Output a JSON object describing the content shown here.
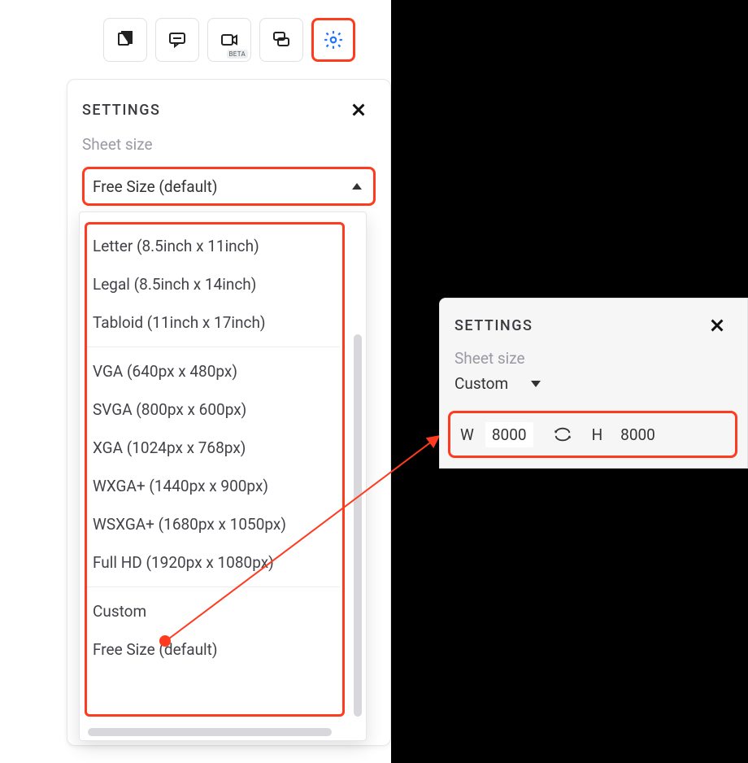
{
  "toolbar": {
    "beta_label": "BETA"
  },
  "panel_left": {
    "title": "SETTINGS",
    "section_label": "Sheet size",
    "selected": "Free Size (default)"
  },
  "dropdown": {
    "group1": [
      "Letter (8.5inch x 11inch)",
      "Legal (8.5inch x 14inch)",
      "Tabloid (11inch x 17inch)"
    ],
    "group2": [
      "VGA (640px x 480px)",
      "SVGA (800px x 600px)",
      "XGA (1024px x 768px)",
      "WXGA+ (1440px x 900px)",
      "WSXGA+ (1680px x 1050px)",
      "Full HD (1920px x 1080px)"
    ],
    "group3": [
      "Custom",
      "Free Size (default)"
    ]
  },
  "panel_right": {
    "title": "SETTINGS",
    "section_label": "Sheet size",
    "selected": "Custom",
    "w_label": "W",
    "w_value": "8000",
    "h_label": "H",
    "h_value": "8000"
  }
}
